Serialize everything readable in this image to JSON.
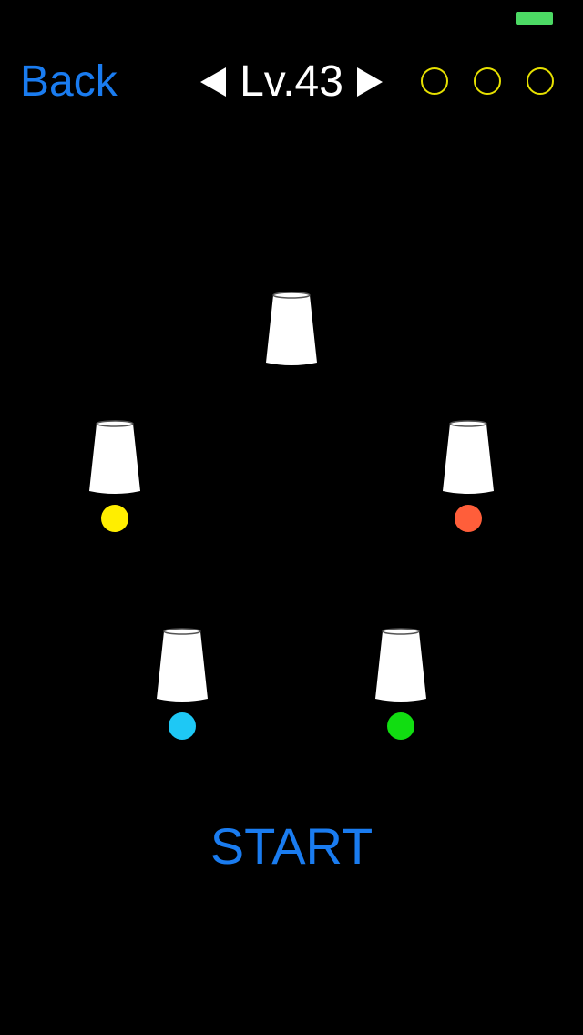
{
  "status": {
    "battery_color": "#4cd964"
  },
  "header": {
    "back_label": "Back",
    "level_label": "Lv.43",
    "prev_icon": "triangle-left",
    "next_icon": "triangle-right",
    "stars": [
      {
        "earned": false
      },
      {
        "earned": false
      },
      {
        "earned": false
      }
    ],
    "star_color": "#e6e000"
  },
  "board": {
    "cups": [
      {
        "id": "top",
        "ball_color": null
      },
      {
        "id": "left",
        "ball_color": "#ffee00"
      },
      {
        "id": "right",
        "ball_color": "#ff5e3a"
      },
      {
        "id": "bottom-left",
        "ball_color": "#1ec8f5"
      },
      {
        "id": "bottom-right",
        "ball_color": "#11dd11"
      }
    ]
  },
  "footer": {
    "start_label": "START"
  }
}
